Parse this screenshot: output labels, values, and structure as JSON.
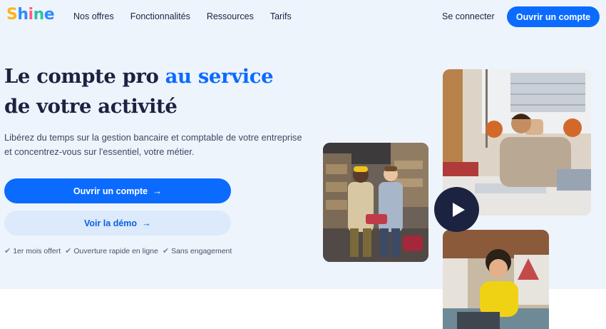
{
  "header": {
    "logo_letters": [
      "S",
      "h",
      "i",
      "n",
      "e"
    ],
    "logo_colors": [
      "#ffb21e",
      "#2f8bff",
      "#ff5a8a",
      "#27c3a2",
      "#2f8bff"
    ],
    "nav": [
      "Nos offres",
      "Fonctionnalités",
      "Ressources",
      "Tarifs"
    ],
    "signin": "Se connecter",
    "cta": "Ouvrir un compte"
  },
  "hero": {
    "title_line1_prefix": "Le compte pro ",
    "title_line1_highlight": "au service",
    "title_line2": "de votre activité",
    "subtitle": "Libérez du temps sur la gestion bancaire et comptable de votre entreprise et concentrez-vous sur l'essentiel, votre métier.",
    "primary_button": "Ouvrir un compte",
    "secondary_button": "Voir la démo",
    "perks": [
      "1er mois offert",
      "Ouverture rapide en ligne",
      "Sans engagement"
    ]
  },
  "colors": {
    "accent": "#0b6bff",
    "dark": "#1c2340",
    "hero_background": "#eef4fc"
  },
  "icons": {
    "arrow": "→",
    "check": "✔"
  }
}
